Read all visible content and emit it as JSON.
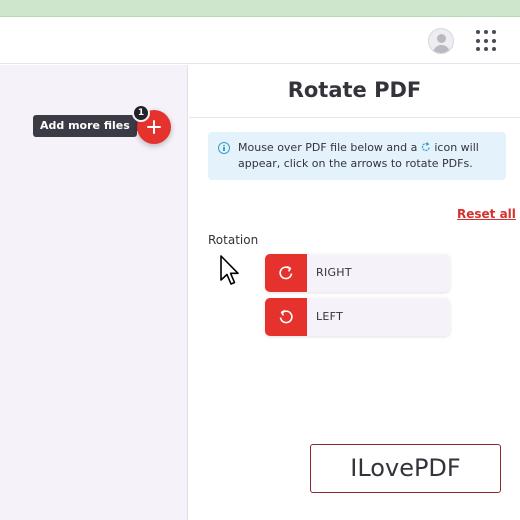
{
  "header": {
    "avatar_icon": "user-avatar-icon",
    "apps_icon": "apps-grid-icon"
  },
  "sidebar": {
    "add_tooltip": "Add more files",
    "file_count": "1",
    "add_icon": "plus-icon"
  },
  "main": {
    "title": "Rotate PDF",
    "info_text_before": "Mouse over PDF file below and a",
    "info_text_after": "icon will appear, click on the arrows to rotate PDFs.",
    "info_icon": "info-icon",
    "reset_label": "Reset all",
    "rotation_label": "Rotation",
    "buttons": [
      {
        "label": "RIGHT",
        "icon": "rotate-clockwise-icon"
      },
      {
        "label": "LEFT",
        "icon": "rotate-counterclockwise-icon"
      }
    ]
  },
  "brand": {
    "text": "ILovePDF"
  },
  "colors": {
    "accent": "#e5322d",
    "info_bg": "#e3f2fb",
    "panel_bg": "#f5f2f9",
    "top_strip": "#cde6cc"
  }
}
